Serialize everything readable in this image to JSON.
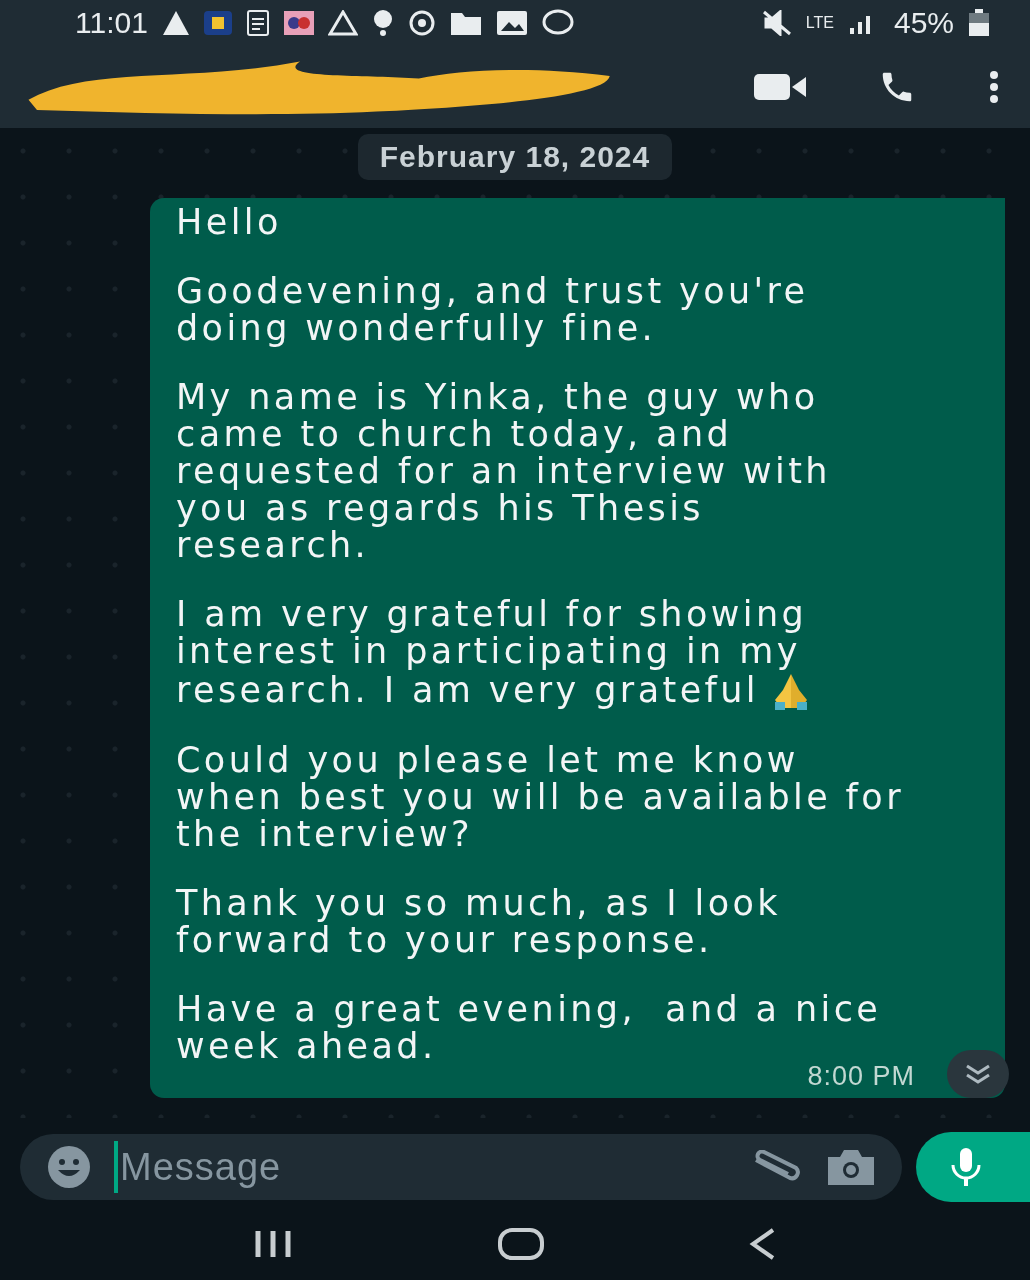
{
  "status_bar": {
    "time": "11:01",
    "network": "LTE",
    "battery": "45%"
  },
  "header": {
    "redacted": true
  },
  "date_chip": "February 18, 2024",
  "message": {
    "paragraphs": [
      {
        "lines": [
          "Hello"
        ]
      },
      {
        "lines": [
          "Goodevening, and trust you're",
          "doing wonderfully fine."
        ]
      },
      {
        "lines": [
          "My name is Yinka, the guy who",
          "came to church today, and",
          "requested for an interview with",
          "you as regards his Thesis",
          "research."
        ]
      },
      {
        "lines": [
          "I am very grateful for showing",
          "interest in participating in my",
          "research. I am very grateful"
        ],
        "emoji": true
      },
      {
        "lines": [
          "Could you please let me know",
          "when best you will be available for",
          "the interview?"
        ]
      },
      {
        "lines": [
          "Thank you so much, as I look",
          "forward to your response."
        ]
      },
      {
        "lines": [
          "Have a great evening,  and a nice",
          "week ahead."
        ]
      }
    ],
    "time": "8:00 PM"
  },
  "composer": {
    "placeholder": "Message"
  }
}
